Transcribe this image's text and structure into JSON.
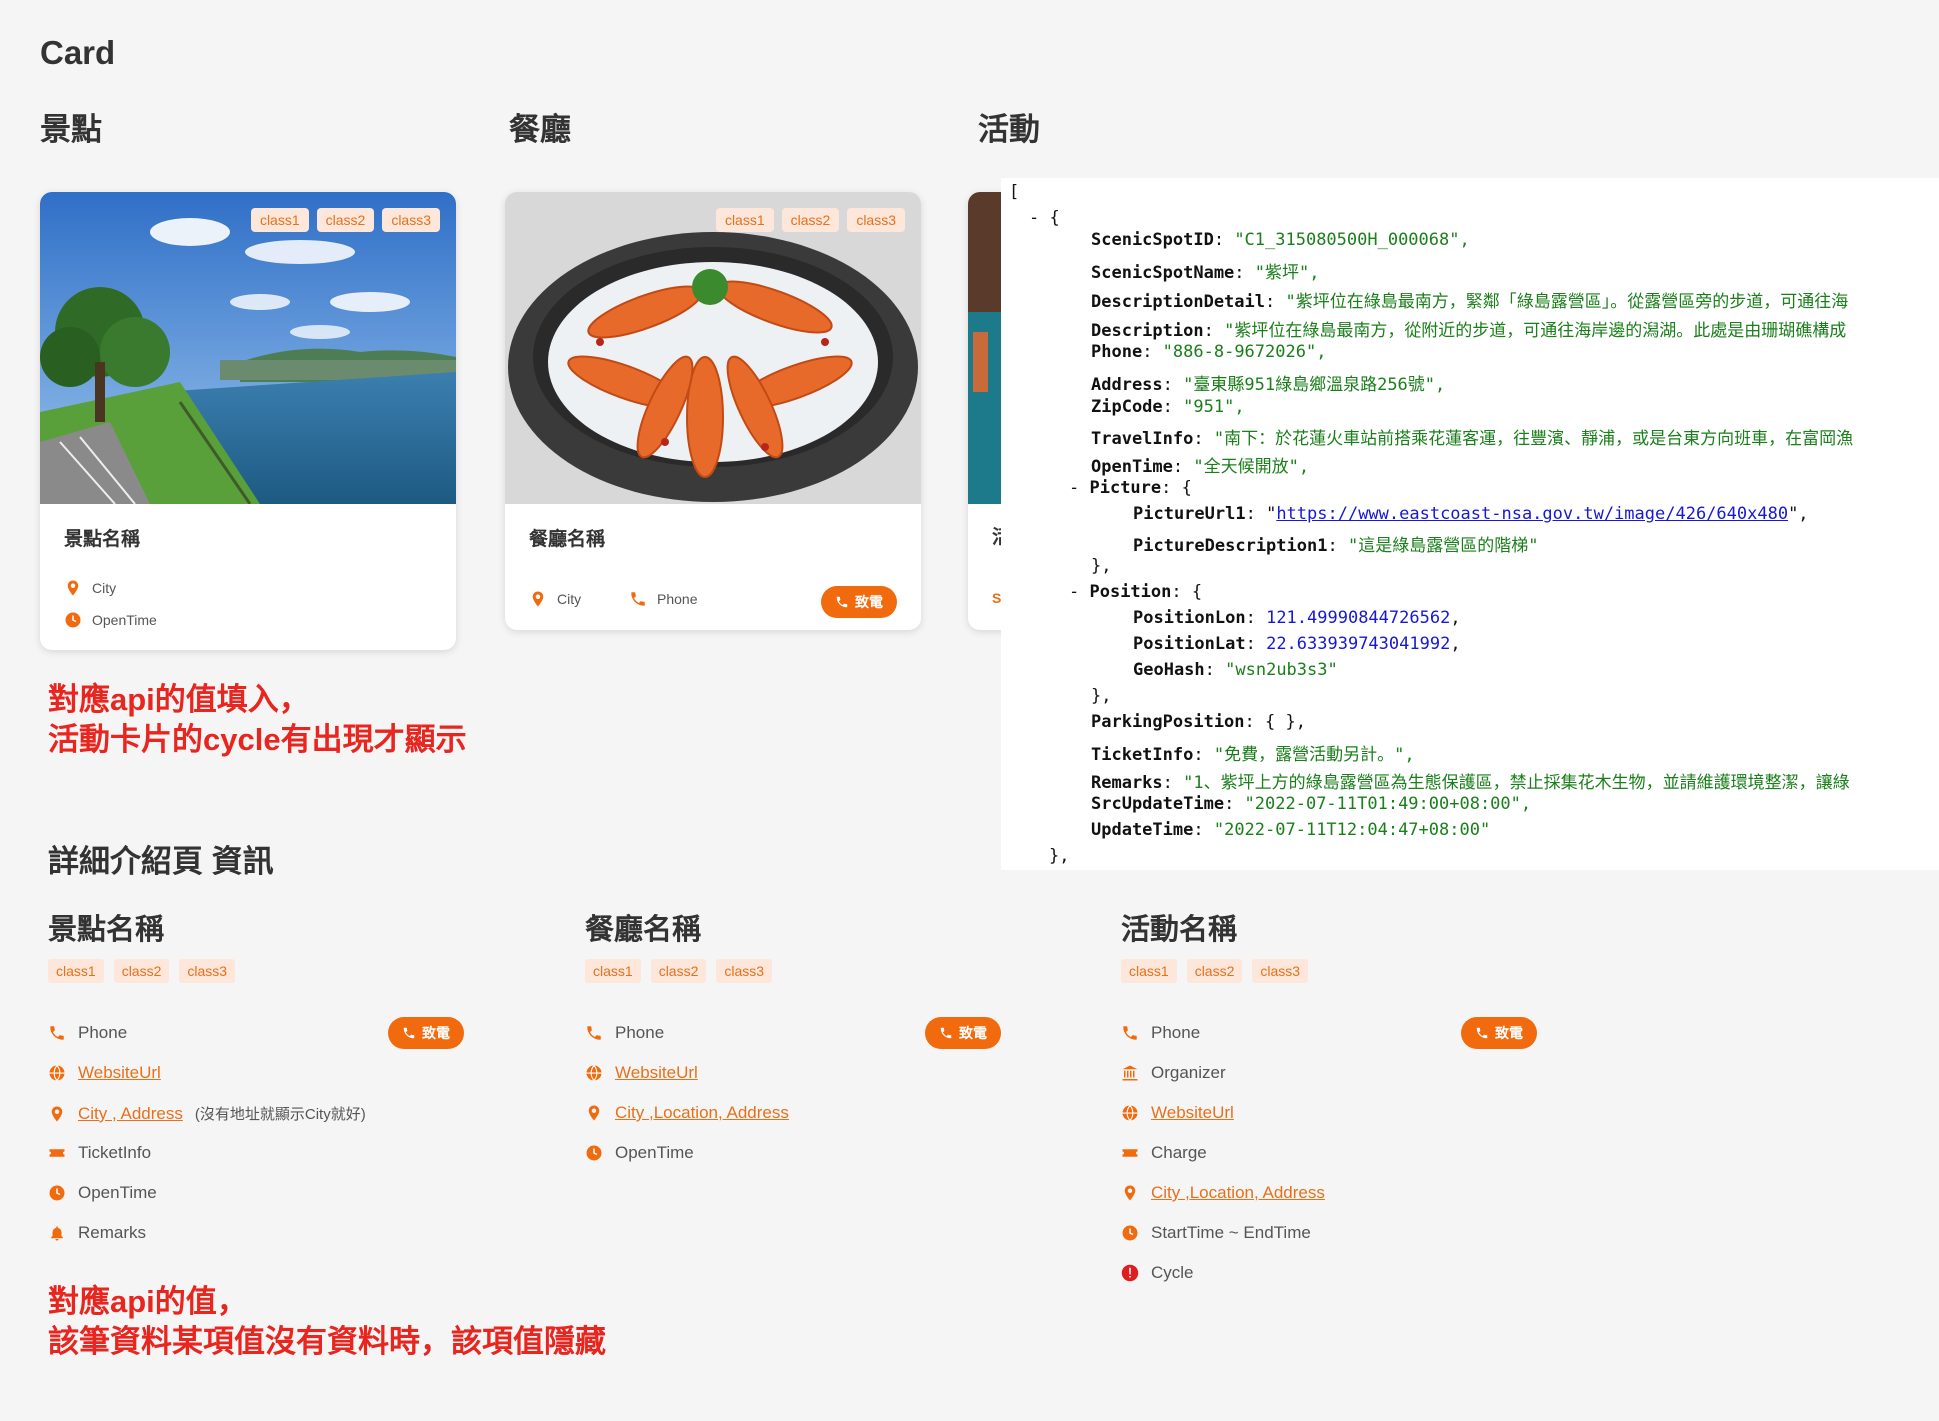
{
  "page": {
    "title": "Card"
  },
  "sections": {
    "scenic": "景點",
    "restaurant": "餐廳",
    "activity": "活動"
  },
  "tags": [
    "class1",
    "class2",
    "class3"
  ],
  "cards": {
    "scenic": {
      "name": "景點名稱",
      "city": "City",
      "open_time": "OpenTime"
    },
    "restaurant": {
      "name": "餐廳名稱",
      "city": "City",
      "phone": "Phone",
      "call": "致電"
    },
    "activity": {
      "name_fragment": "活",
      "city_fragment": "S"
    }
  },
  "notes": {
    "card_note_line1": "對應api的值填入，",
    "card_note_line2": "活動卡片的cycle有出現才顯示",
    "detail_note_line1": "對應api的值，",
    "detail_note_line2": "該筆資料某項值沒有資料時，該項值隱藏"
  },
  "json_view": {
    "open_bracket": "[",
    "collapse_marker": "- {",
    "fields": {
      "ScenicSpotID": "\"C1_315080500H_000068\",",
      "ScenicSpotName": "\"紫坪\",",
      "DescriptionDetail": "\"紫坪位在綠島最南方，緊鄰「綠島露營區」。從露營區旁的步道，可通往海",
      "Description": "\"紫坪位在綠島最南方，從附近的步道，可通往海岸邊的潟湖。此處是由珊瑚礁構成",
      "Phone": "\"886-8-9672026\",",
      "Address": "\"臺東縣951綠島鄉溫泉路256號\",",
      "ZipCode": "\"951\",",
      "TravelInfo": "\"南下：於花蓮火車站前搭乘花蓮客運，往豐濱、靜浦，或是台東方向班車，在富岡漁",
      "OpenTime": "\"全天候開放\","
    },
    "picture_key": "Picture",
    "picture_url_key": "PictureUrl1",
    "picture_url": "https://www.eastcoast-nsa.gov.tw/image/426/640x480",
    "picture_url_tail": "\",",
    "picture_desc_key": "PictureDescription1",
    "picture_desc": "\"這是綠島露營區的階梯\"",
    "position_key": "Position",
    "position_lon_key": "PositionLon",
    "position_lon": "121.49990844726562",
    "position_lat_key": "PositionLat",
    "position_lat": "22.633939743041992",
    "geohash_key": "GeoHash",
    "geohash": "\"wsn2ub3s3\"",
    "parking_key": "ParkingPosition",
    "parking_val": "{ },",
    "ticket_key": "TicketInfo",
    "ticket_val": "\"免費，露營活動另計。\",",
    "remarks_key": "Remarks",
    "remarks_val": "\"1、紫坪上方的綠島露營區為生態保護區，禁止採集花木生物，並請維護環境整潔，讓綠",
    "src_update_key": "SrcUpdateTime",
    "src_update_val": "\"2022-07-11T01:49:00+08:00\",",
    "update_key": "UpdateTime",
    "update_val": "\"2022-07-11T12:04:47+08:00\"",
    "close_obj": "},",
    "close_brace": "},",
    "close_brace_plain": "},"
  },
  "detail": {
    "heading": "詳細介紹頁 資訊",
    "scenic": {
      "title": "景點名稱",
      "phone": "Phone",
      "call": "致電",
      "website": "WebsiteUrl",
      "address": "City , Address",
      "address_hint": "(沒有地址就顯示City就好)",
      "ticket": "TicketInfo",
      "open_time": "OpenTime",
      "remarks": "Remarks"
    },
    "restaurant": {
      "title": "餐廳名稱",
      "phone": "Phone",
      "call": "致電",
      "website": "WebsiteUrl",
      "address": "City ,Location, Address",
      "open_time": "OpenTime"
    },
    "activity": {
      "title": "活動名稱",
      "phone": "Phone",
      "call": "致電",
      "organizer": "Organizer",
      "website": "WebsiteUrl",
      "charge": "Charge",
      "address": "City ,Location, Address",
      "time": "StartTime ~ EndTime",
      "cycle": "Cycle"
    }
  },
  "colors": {
    "accent": "#f26a0e",
    "note_red": "#e8251e",
    "tag_bg": "#fde6da"
  }
}
